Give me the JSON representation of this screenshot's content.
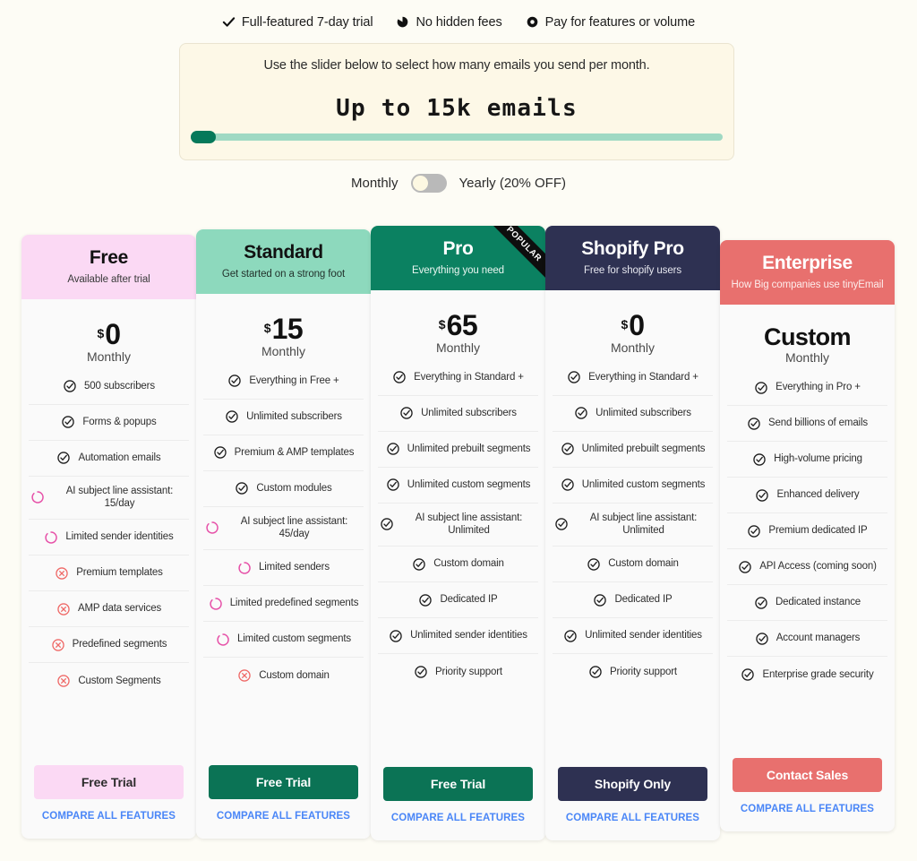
{
  "badges": [
    {
      "icon": "check-icon",
      "label": "Full-featured 7-day trial"
    },
    {
      "icon": "pie-chart-icon",
      "label": "No hidden fees"
    },
    {
      "icon": "donut-icon",
      "label": "Pay for features or volume"
    }
  ],
  "slider": {
    "caption": "Use the slider below to select how many emails you send per month.",
    "value_label": "Up to 15k emails",
    "fill_percent": 0,
    "track_color": "#9fd9c3",
    "thumb_color": "#06795a",
    "panel_color": "#fdf8e7"
  },
  "billing": {
    "monthly_label": "Monthly",
    "yearly_label": "Yearly (20% OFF)",
    "selected": "Monthly"
  },
  "plans": [
    {
      "name": "Free",
      "tagline": "Available after trial",
      "header_bg": "#fbd9f4",
      "header_text": "#111111",
      "header_sub_text": "#3a3a3a",
      "ribbon": null,
      "currency": "$",
      "amount": "0",
      "amount_is_custom": false,
      "period": "Monthly",
      "features": [
        {
          "status": "included",
          "text": "500 subscribers"
        },
        {
          "status": "included",
          "text": "Forms & popups"
        },
        {
          "status": "included",
          "text": "Automation emails"
        },
        {
          "status": "limited",
          "text": "AI subject line assistant: 15/day"
        },
        {
          "status": "limited",
          "text": "Limited sender identities"
        },
        {
          "status": "excluded",
          "text": "Premium templates"
        },
        {
          "status": "excluded",
          "text": "AMP data services"
        },
        {
          "status": "excluded",
          "text": "Predefined segments"
        },
        {
          "status": "excluded",
          "text": "Custom Segments"
        }
      ],
      "cta_label": "Free Trial",
      "cta_bg": "#fbd9f4",
      "cta_color": "#2b2b2b",
      "compare_label": "COMPARE ALL FEATURES"
    },
    {
      "name": "Standard",
      "tagline": "Get started on a strong foot",
      "header_bg": "#8dd9bd",
      "header_text": "#111111",
      "header_sub_text": "#23332d",
      "ribbon": null,
      "currency": "$",
      "amount": "15",
      "amount_is_custom": false,
      "period": "Monthly",
      "features": [
        {
          "status": "included",
          "text": "Everything in Free +"
        },
        {
          "status": "included",
          "text": "Unlimited subscribers"
        },
        {
          "status": "included",
          "text": "Premium & AMP templates"
        },
        {
          "status": "included",
          "text": "Custom modules"
        },
        {
          "status": "limited",
          "text": "AI subject line assistant: 45/day"
        },
        {
          "status": "limited",
          "text": "Limited senders"
        },
        {
          "status": "limited",
          "text": "Limited predefined segments"
        },
        {
          "status": "limited",
          "text": "Limited custom segments"
        },
        {
          "status": "excluded",
          "text": "Custom domain"
        }
      ],
      "cta_label": "Free Trial",
      "cta_bg": "#0b7355",
      "cta_color": "#ffffff",
      "compare_label": "COMPARE ALL FEATURES"
    },
    {
      "name": "Pro",
      "tagline": "Everything you need",
      "header_bg": "#0b8161",
      "header_text": "#ffffff",
      "header_sub_text": "#eaf6f1",
      "ribbon": "POPULAR",
      "currency": "$",
      "amount": "65",
      "amount_is_custom": false,
      "period": "Monthly",
      "features": [
        {
          "status": "included",
          "text": "Everything in Standard +"
        },
        {
          "status": "included",
          "text": "Unlimited subscribers"
        },
        {
          "status": "included",
          "text": "Unlimited prebuilt segments"
        },
        {
          "status": "included",
          "text": "Unlimited custom segments"
        },
        {
          "status": "included",
          "text": "AI subject line assistant: Unlimited"
        },
        {
          "status": "included",
          "text": "Custom domain"
        },
        {
          "status": "included",
          "text": "Dedicated IP"
        },
        {
          "status": "included",
          "text": "Unlimited sender identities"
        },
        {
          "status": "included",
          "text": "Priority support"
        }
      ],
      "cta_label": "Free Trial",
      "cta_bg": "#0b7355",
      "cta_color": "#ffffff",
      "compare_label": "COMPARE ALL FEATURES"
    },
    {
      "name": "Shopify Pro",
      "tagline": "Free for shopify users",
      "header_bg": "#2e3152",
      "header_text": "#ffffff",
      "header_sub_text": "#e6e7ef",
      "ribbon": null,
      "currency": "$",
      "amount": "0",
      "amount_is_custom": false,
      "period": "Monthly",
      "features": [
        {
          "status": "included",
          "text": "Everything in Standard +"
        },
        {
          "status": "included",
          "text": "Unlimited subscribers"
        },
        {
          "status": "included",
          "text": "Unlimited prebuilt segments"
        },
        {
          "status": "included",
          "text": "Unlimited custom segments"
        },
        {
          "status": "included",
          "text": "AI subject line assistant: Unlimited"
        },
        {
          "status": "included",
          "text": "Custom domain"
        },
        {
          "status": "included",
          "text": "Dedicated IP"
        },
        {
          "status": "included",
          "text": "Unlimited sender identities"
        },
        {
          "status": "included",
          "text": "Priority support"
        }
      ],
      "cta_label": "Shopify Only",
      "cta_bg": "#2e3152",
      "cta_color": "#ffffff",
      "compare_label": "COMPARE ALL FEATURES"
    },
    {
      "name": "Enterprise",
      "tagline": "How Big companies use tinyEmail",
      "header_bg": "#e8706e",
      "header_text": "#ffffff",
      "header_sub_text": "#fdeceb",
      "ribbon": null,
      "currency": "",
      "amount": "Custom",
      "amount_is_custom": true,
      "period": "Monthly",
      "features": [
        {
          "status": "included",
          "text": "Everything in Pro +"
        },
        {
          "status": "included",
          "text": "Send billions of emails"
        },
        {
          "status": "included",
          "text": "High-volume pricing"
        },
        {
          "status": "included",
          "text": "Enhanced delivery"
        },
        {
          "status": "included",
          "text": "Premium dedicated IP"
        },
        {
          "status": "included",
          "text": "API Access (coming soon)"
        },
        {
          "status": "included",
          "text": "Dedicated instance"
        },
        {
          "status": "included",
          "text": "Account managers"
        },
        {
          "status": "included",
          "text": "Enterprise grade security"
        }
      ],
      "cta_label": "Contact Sales",
      "cta_bg": "#e8706e",
      "cta_color": "#ffffff",
      "compare_label": "COMPARE ALL FEATURES"
    }
  ],
  "icon_colors": {
    "included": "#1d1d1d",
    "limited": "#e651a8",
    "excluded": "#ef6a68"
  }
}
